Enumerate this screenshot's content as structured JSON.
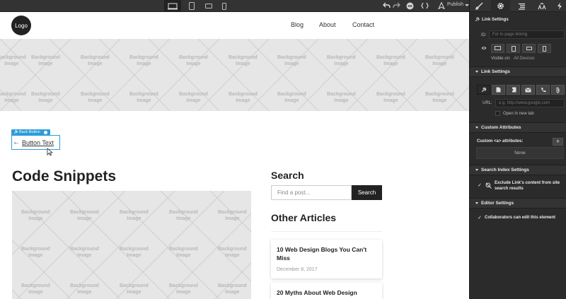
{
  "toolbar": {
    "publish_label": "Publish",
    "devices": [
      "desktop",
      "tablet",
      "mobile-landscape",
      "mobile-portrait"
    ]
  },
  "navbar": {
    "logo": "Logo",
    "links": [
      "Blog",
      "About",
      "Contact"
    ]
  },
  "hero": {
    "bg_label_line1": "Background",
    "bg_label_line2": "Image"
  },
  "selection": {
    "tag_label": "Back Button"
  },
  "back_button": {
    "text": "Button Text"
  },
  "main": {
    "title": "Code Snippets"
  },
  "sidebar": {
    "search_heading": "Search",
    "search_placeholder": "Find a post...",
    "search_button": "Search",
    "other_heading": "Other Articles",
    "articles": [
      {
        "title": "10 Web Design Blogs You Can't Miss",
        "date": "December 8, 2017"
      },
      {
        "title": "20 Myths About Web Design",
        "date": ""
      }
    ]
  },
  "panel": {
    "link_settings_title": "Link Settings",
    "id_label": "ID:",
    "id_placeholder": "For in-page linking",
    "visible_on_label": "Visible on:",
    "visible_on_value": "All Devices",
    "link_settings_section": "Link Settings",
    "url_label": "URL:",
    "url_placeholder": "e.g. http://www.google.com",
    "open_new_tab": "Open in new tab",
    "custom_attributes_section": "Custom Attributes",
    "custom_attributes_label": "Custom <a> attributes:",
    "none_label": "None",
    "search_index_section": "Search Index Settings",
    "exclude_label_line1": "Exclude Link's content from site",
    "exclude_label_line2": "search results",
    "editor_section": "Editor Settings",
    "collaborators_label": "Collaborators can edit this element"
  }
}
